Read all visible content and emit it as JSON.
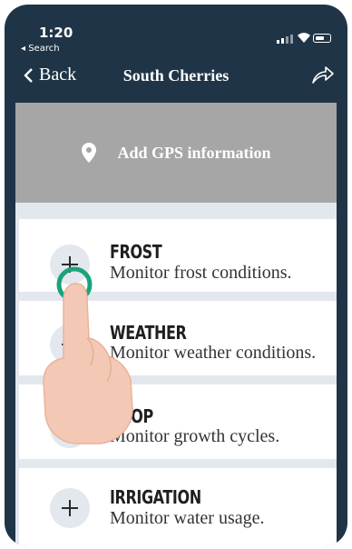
{
  "status_bar": {
    "time": "1:20",
    "back_app": "◂ Search"
  },
  "nav": {
    "back_label": "Back",
    "title": "South Cherries"
  },
  "gps": {
    "label": "Add GPS information"
  },
  "cards": [
    {
      "title": "FROST",
      "description": "Monitor frost conditions."
    },
    {
      "title": "WEATHER",
      "description": "Monitor weather conditions."
    },
    {
      "title": "CROP",
      "description": "Monitor growth cycles."
    },
    {
      "title": "IRRIGATION",
      "description": "Monitor water usage."
    }
  ],
  "colors": {
    "header_bg": "#1f3547",
    "gps_bg": "#a6a6a6",
    "tap_ring": "#1aa37a"
  }
}
